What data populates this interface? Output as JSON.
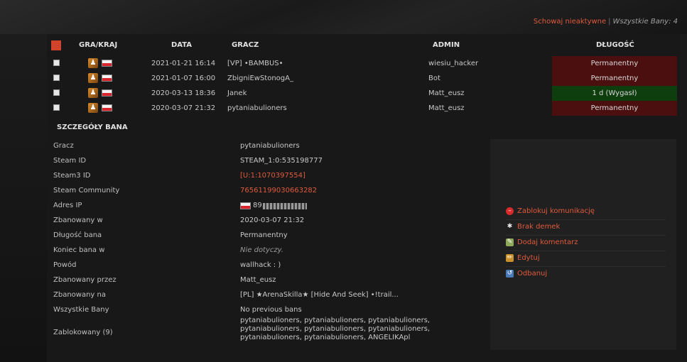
{
  "top": {
    "hide_inactive": "Schowaj nieaktywne",
    "separator": "|",
    "all_bans": "Wszystkie Bany: 4"
  },
  "table": {
    "headers": [
      "GRA/KRAJ",
      "DATA",
      "GRACZ",
      "ADMIN",
      "DŁUGOŚĆ"
    ],
    "rows": [
      {
        "date": "2021-01-21 16:14",
        "player": "[VP] •BAMBUS•",
        "admin": "wiesiu_hacker",
        "length": "Permanentny",
        "status": "red"
      },
      {
        "date": "2021-01-07 16:00",
        "player": "ZbigniEwStonogA_",
        "admin": "Bot",
        "length": "Permanentny",
        "status": "red"
      },
      {
        "date": "2020-03-13 18:36",
        "player": "Janek",
        "admin": "Matt_eusz",
        "length": "1 d (Wygasł)",
        "status": "green"
      },
      {
        "date": "2020-03-07 21:32",
        "player": "pytaniabulioners",
        "admin": "Matt_eusz",
        "length": "Permanentny",
        "status": "red"
      }
    ]
  },
  "details": {
    "title": "SZCZEGÓŁY BANA",
    "rows": [
      {
        "label": "Gracz",
        "value": "pytaniabulioners"
      },
      {
        "label": "Steam ID",
        "value": "STEAM_1:0:535198777"
      },
      {
        "label": "Steam3 ID",
        "value": "[U:1:1070397554]"
      },
      {
        "label": "Steam Community",
        "value": "76561199030663282"
      },
      {
        "label": "Adres IP",
        "value": "89."
      },
      {
        "label": "Zbanowany w",
        "value": "2020-03-07 21:32"
      },
      {
        "label": "Długość bana",
        "value": "Permanentny"
      },
      {
        "label": "Koniec bana w",
        "value": "Nie dotyczy."
      },
      {
        "label": "Powód",
        "value": "wallhack : )"
      },
      {
        "label": "Zbanowany przez",
        "value": "Matt_eusz"
      },
      {
        "label": "Zbanowany na",
        "value": "[PL] ★ArenaSkilla★ [Hide And Seek] •!trail..."
      },
      {
        "label": "Wszystkie Bany",
        "value": "No previous bans"
      },
      {
        "label": "Zablokowany (9)",
        "value": "pytaniabulioners, pytaniabulioners, pytaniabulioners, pytaniabulioners, pytaniabulioners, pytaniabulioners, pytaniabulioners, pytaniabulioners, ANGELIKApl"
      }
    ]
  },
  "actions": [
    {
      "label": "Zablokuj komunikację",
      "icon": "block-icon"
    },
    {
      "label": "Brak demek",
      "icon": "demo-icon"
    },
    {
      "label": "Dodaj komentarz",
      "icon": "comment-icon"
    },
    {
      "label": "Edytuj",
      "icon": "pencil-icon"
    },
    {
      "label": "Odbanuj",
      "icon": "unban-icon"
    }
  ],
  "colors": {
    "accent": "#e05a3c",
    "permanent_bg": "#4b0f0f",
    "expired_bg": "#0e3d0e"
  }
}
